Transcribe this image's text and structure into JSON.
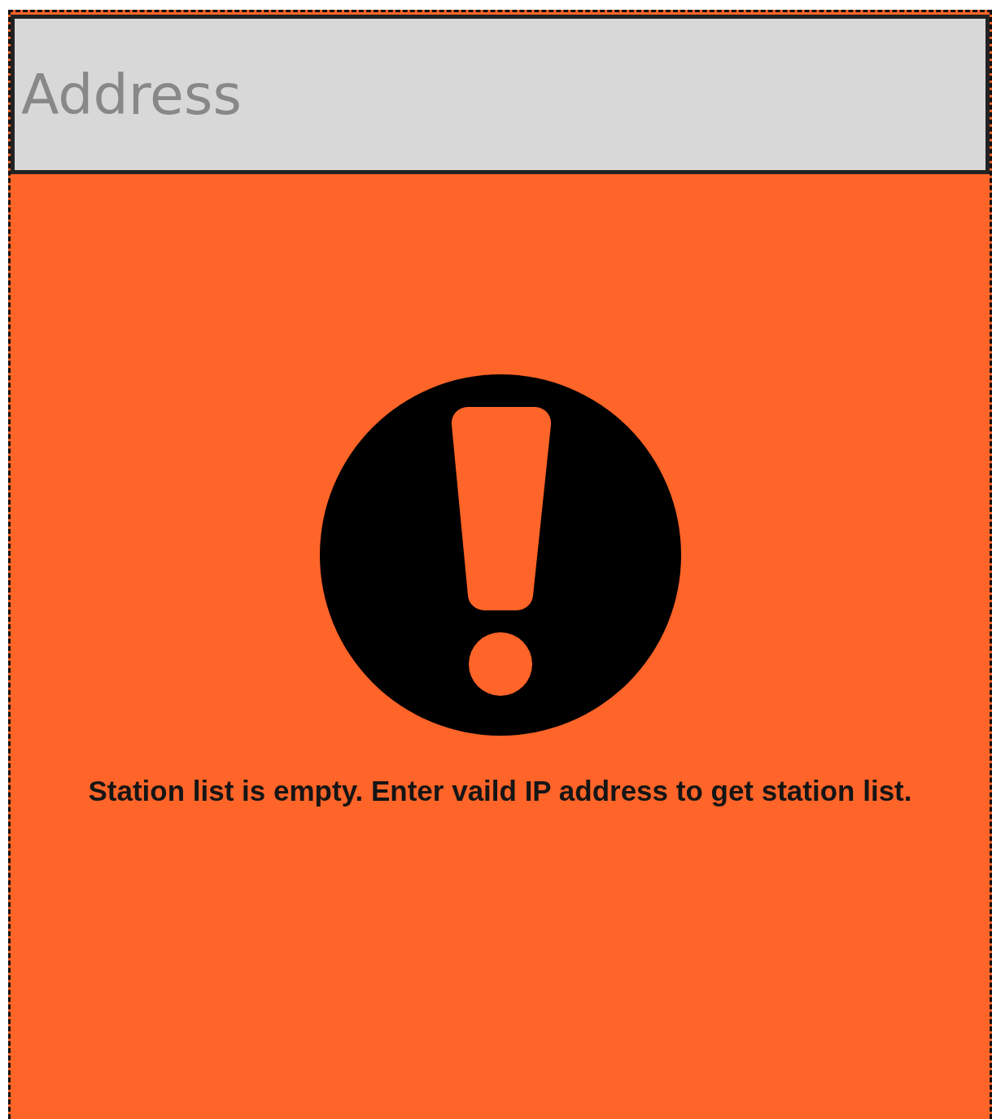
{
  "address_field": {
    "placeholder": "Address"
  },
  "empty_state": {
    "message": "Station list is empty. Enter vaild IP address to get station list."
  }
}
